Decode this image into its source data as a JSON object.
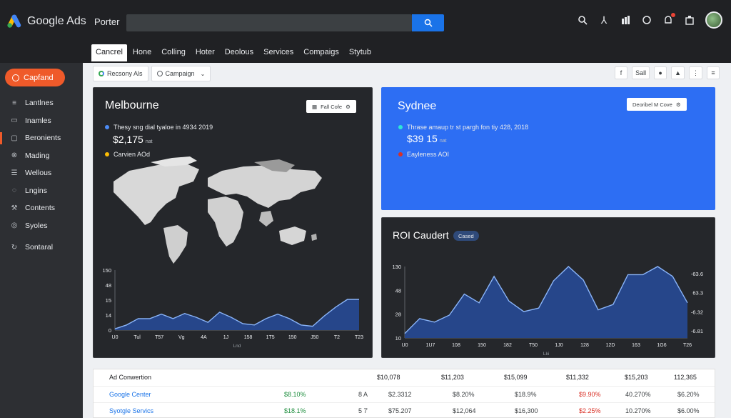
{
  "header": {
    "brand": "Google Ads",
    "account": "Porter",
    "search_placeholder": "",
    "icons": [
      "search-icon",
      "tools-icon",
      "reports-icon",
      "help-icon",
      "notifications-icon",
      "settings-icon"
    ]
  },
  "tabs": [
    {
      "label": "Cancrel",
      "active": true
    },
    {
      "label": "Hone"
    },
    {
      "label": "Colling"
    },
    {
      "label": "Hoter"
    },
    {
      "label": "Deolous"
    },
    {
      "label": "Services"
    },
    {
      "label": "Compaigs"
    },
    {
      "label": "Stytub"
    }
  ],
  "sidebar": {
    "create_label": "Capfand",
    "items": [
      {
        "label": "Lantlnes",
        "icon": "≡"
      },
      {
        "label": "Inamles",
        "icon": "▭"
      },
      {
        "label": "Beronients",
        "icon": "▢",
        "active": true
      },
      {
        "label": "Mading",
        "icon": "⊗"
      },
      {
        "label": "Wellous",
        "icon": "☰"
      },
      {
        "label": "Lngins",
        "icon": "◌"
      },
      {
        "label": "Contents",
        "icon": "⚒"
      },
      {
        "label": "Syoles",
        "icon": "◎"
      },
      {
        "label": "Sontaral",
        "icon": "↻"
      }
    ]
  },
  "filters": {
    "chip1": "Recsony Als",
    "chip2": "Campaign"
  },
  "right_tools": {
    "t1": "f",
    "t2": "Sall",
    "t3": "●",
    "t4": "▲",
    "t5": "⋮",
    "t6": "≡"
  },
  "melbourne": {
    "title": "Melbourne",
    "button": "Fall Cofe",
    "metric1_label": "Thesy sng dial tyaloe in 4934 2019",
    "metric1_value": "$2,175",
    "metric1_suffix": "nat",
    "metric2_label": "Carvien AOd",
    "chart": {
      "y_ticks": [
        "150",
        "48",
        "15",
        "14",
        "0"
      ],
      "x_ticks": [
        "U0",
        "Tul",
        "T57",
        "Vg",
        "4A",
        "1J",
        "158",
        "1T5",
        "150",
        "J50",
        "T2",
        "T23"
      ],
      "x_label": "Lnd"
    }
  },
  "sydnee": {
    "title": "Sydnee",
    "button": "Deoribel M Cove",
    "metric1_label": "Thrase amaup tr st pargh fon tiy 428, 2018",
    "metric1_value": "$39 15",
    "metric1_suffix": "nat",
    "metric2_label": "Eayleness AOI",
    "metric1_dot": "#2ee6d6",
    "metric2_dot": "#d93025"
  },
  "roi": {
    "title": "ROI Caudert",
    "badge": "Cased",
    "chart": {
      "y_ticks": [
        "130",
        "48",
        "28",
        "10"
      ],
      "right_ticks": [
        "-63.6",
        "63.3",
        "-6.32",
        "-6.81"
      ],
      "x_ticks": [
        "U0",
        "1U7",
        "108",
        "150",
        "182",
        "T50",
        "1J0",
        "128",
        "12D",
        "163",
        "1G6",
        "T26"
      ],
      "x_label": "Lki"
    }
  },
  "chart_data": [
    {
      "type": "area",
      "title": "Melbourne",
      "y_ticks": [
        "150",
        "48",
        "15",
        "14",
        "0"
      ],
      "x": [
        "U0",
        "Tul",
        "T57",
        "Vg",
        "4A",
        "1J",
        "158",
        "1T5",
        "150",
        "J50",
        "T2",
        "T23"
      ],
      "xlabel": "Lnd",
      "series": [
        {
          "values": [
            2,
            8,
            18,
            18,
            25,
            18,
            26,
            20,
            12,
            28,
            20,
            10,
            8,
            18,
            25,
            18,
            8,
            6,
            22,
            36,
            48,
            48
          ]
        }
      ],
      "ylim": [
        0,
        150
      ]
    },
    {
      "type": "area",
      "title": "ROI Caudert",
      "y_ticks": [
        "130",
        "48",
        "28",
        "10"
      ],
      "x": [
        "U0",
        "1U7",
        "108",
        "150",
        "182",
        "T50",
        "1J0",
        "128",
        "12D",
        "163",
        "1G6",
        "T26"
      ],
      "xlabel": "Lki",
      "series": [
        {
          "values": [
            5,
            22,
            18,
            26,
            50,
            40,
            70,
            42,
            30,
            34,
            65,
            82,
            66,
            32,
            38,
            72,
            72,
            88,
            70,
            40
          ]
        }
      ],
      "ylim": [
        0,
        130
      ]
    }
  ],
  "table": {
    "header": [
      "Ad Conwertion",
      "$10,078",
      "$11,203",
      "$15,099",
      "$11,332",
      "$15,203",
      "112,365"
    ],
    "rows": [
      {
        "name": "Google Center",
        "pct": "$8.10%",
        "code": "8 A",
        "c1": "$2.3312",
        "c2": "$8.20%",
        "c3": "$18.9%",
        "c4": "$9.90%",
        "c5": "40.270%",
        "c6": "$6.20%"
      },
      {
        "name": "Syotgle Servics",
        "pct": "$18.1%",
        "code": "5 7̇",
        "c1": "$75.207",
        "c2": "$12,064",
        "c3": "$16,300",
        "c4": "$2.25%",
        "c5": "10.270%",
        "c6": "$6.00%"
      }
    ],
    "colors": {
      "green": "#1e8e3e",
      "red": "#d93025",
      "link": "#1a73e8"
    }
  }
}
